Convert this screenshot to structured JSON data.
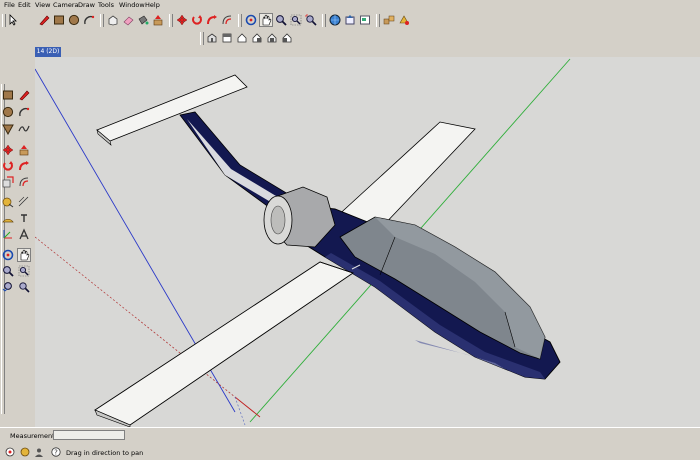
{
  "menu": [
    "File",
    "Edit",
    "View",
    "Camera",
    "Draw",
    "Tools",
    "Window",
    "Help"
  ],
  "toolbar_main_icons": [
    "select-icon",
    "pencil-icon",
    "rectangle-icon",
    "circle-icon",
    "arc-icon",
    "make-component-icon",
    "eraser-icon",
    "paint-bucket-icon",
    "push-pull-icon",
    "move-icon",
    "rotate-icon",
    "follow-me-icon",
    "orbit-icon",
    "pan-icon",
    "zoom-icon",
    "zoom-extents-icon",
    "get-models-icon",
    "share-model-icon",
    "send-to-layout-icon",
    "components-icon",
    "materials-icon"
  ],
  "toolbar_views_icons": [
    "iso-view-icon",
    "top-view-icon",
    "front-view-icon",
    "right-view-icon",
    "back-view-icon",
    "left-view-icon"
  ],
  "scene_tab": "14 (2D)",
  "status": {
    "measurements_label": "Measurements",
    "measurements_value": "",
    "hint": "Drag in direction to pan"
  },
  "colors": {
    "toolbar_bg": "#d4d0c8",
    "viewport_bg": "#d8d8d6",
    "fuselage": "#131850",
    "wing": "#f4f4f2",
    "canopy": "#7f868d",
    "scene_tab": "#3a5fb4"
  }
}
